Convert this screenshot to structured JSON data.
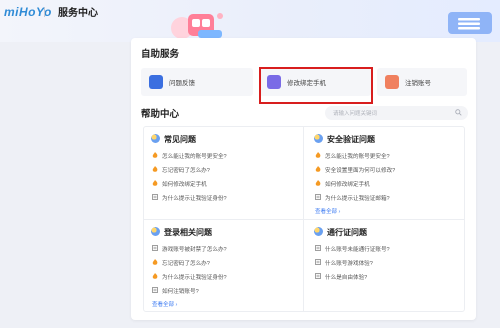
{
  "header": {
    "logo": "miHoYo",
    "title": "服务中心"
  },
  "self_service": {
    "title": "自助服务",
    "items": [
      {
        "label": "问题反馈",
        "icon": "chat-bubble-icon",
        "color": "#3b6fe0"
      },
      {
        "label": "修改绑定手机",
        "icon": "phone-lock-icon",
        "color": "#7a6be6"
      },
      {
        "label": "注销账号",
        "icon": "account-cancel-icon",
        "color": "#f0805f"
      }
    ]
  },
  "help": {
    "title": "帮助中心",
    "search_placeholder": "请输入问题关键词",
    "groups": [
      {
        "title": "常见问题",
        "questions": [
          "怎么能让我的账号更安全?",
          "忘记密码了怎么办?",
          "如何修改绑定手机",
          "为什么提示让我验证身份?"
        ],
        "question_icons": [
          "fire",
          "fire",
          "fire",
          "doc"
        ]
      },
      {
        "title": "安全验证问题",
        "questions": [
          "怎么能让我的账号更安全?",
          "安全设置里面为何可以修改?",
          "如何修改绑定手机",
          "为什么提示让我验证邮箱?"
        ],
        "question_icons": [
          "fire",
          "fire",
          "fire",
          "doc"
        ],
        "more": "查看全部"
      },
      {
        "title": "登录相关问题",
        "questions": [
          "游戏账号被封禁了怎么办?",
          "忘记密码了怎么办?",
          "为什么提示让我验证身份?",
          "如何注销账号?"
        ],
        "question_icons": [
          "doc",
          "fire",
          "fire",
          "doc"
        ],
        "more": "查看全部"
      },
      {
        "title": "通行证问题",
        "questions": [
          "什么账号未能通行证账号?",
          "什么账号游戏体验?",
          "什么是自由体验?"
        ],
        "question_icons": [
          "doc",
          "doc",
          "doc"
        ]
      }
    ]
  },
  "colors": {
    "accent": "#3d7bf2",
    "highlight": "#d81e1e",
    "fire": "#f59a23"
  }
}
